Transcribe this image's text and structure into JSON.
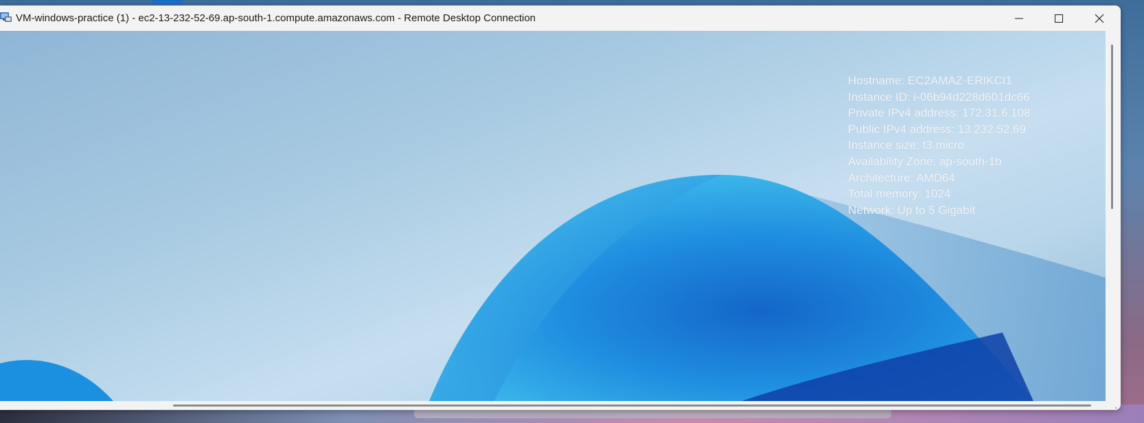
{
  "window": {
    "title": "VM-windows-practice (1) - ec2-13-232-52-69.ap-south-1.compute.amazonaws.com - Remote Desktop Connection",
    "app_icon": "remote-desktop-icon",
    "buttons": {
      "minimize_icon": "minimize-icon",
      "maximize_icon": "maximize-icon",
      "close_icon": "close-icon"
    }
  },
  "desktop_info": {
    "hostname": "Hostname: EC2AMAZ-ERIKCI1",
    "instance_id": "Instance ID: i-06b94d228d601dc66",
    "private_ip": "Private IPv4 address: 172.31.6.108",
    "public_ip": "Public IPv4 address: 13.232.52.69",
    "instance_size": "Instance size: t3.micro",
    "availability_zone": "Availability Zone: ap-south-1b",
    "architecture": "Architecture: AMD64",
    "total_memory": "Total memory: 1024",
    "network": "Network: Up to 5 Gigabit"
  },
  "colors": {
    "accent": "#1c6fc9",
    "info_text": "#f2f6fa",
    "titlebar_bg": "#f3f3f3"
  }
}
